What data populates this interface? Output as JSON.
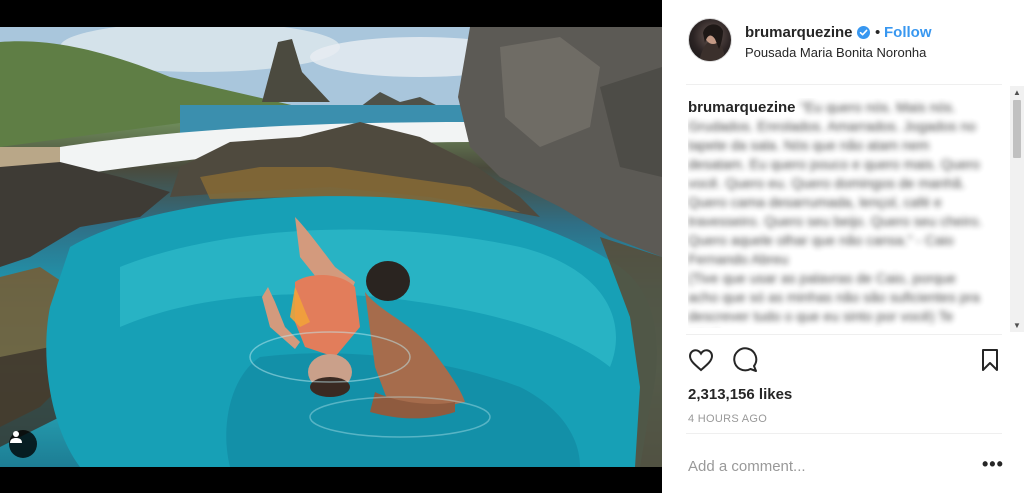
{
  "post": {
    "media": {
      "user_tag_icon": "person-icon"
    },
    "header": {
      "username": "brumarquezine",
      "verified_icon": "verified-badge-icon",
      "separator": "•",
      "follow_label": "Follow",
      "location": "Pousada Maria Bonita Noronha"
    },
    "caption": {
      "username": "brumarquezine",
      "text": "\"Eu quero nós. Mais nós. Grudados. Enrolados. Amarrados. Jogados no tapete da sala. Nós que não atam nem desatam. Eu quero pouco e quero mais. Quero você. Quero eu. Quero domingos de manhã. Quero cama desarrumada, lençol, café e travesseiro. Quero seu beijo. Quero seu cheiro. Quero aquele olhar que não cansa.\" - Caio Fernando Abreu\n(Tive que usar as palavras de Caio, porque acho que só as minhas não são suficientes pra descrever tudo o que eu sinto por você) Te amo!"
    },
    "actions": {
      "like_icon": "heart-icon",
      "comment_icon": "comment-icon",
      "save_icon": "bookmark-icon"
    },
    "likes": "2,313,156 likes",
    "timestamp": "4 HOURS AGO",
    "comment_box": {
      "placeholder": "Add a comment...",
      "more_label": "•••"
    },
    "colors": {
      "follow": "#3897f0",
      "text": "#262626",
      "muted": "#999999",
      "divider": "#efefef"
    }
  }
}
